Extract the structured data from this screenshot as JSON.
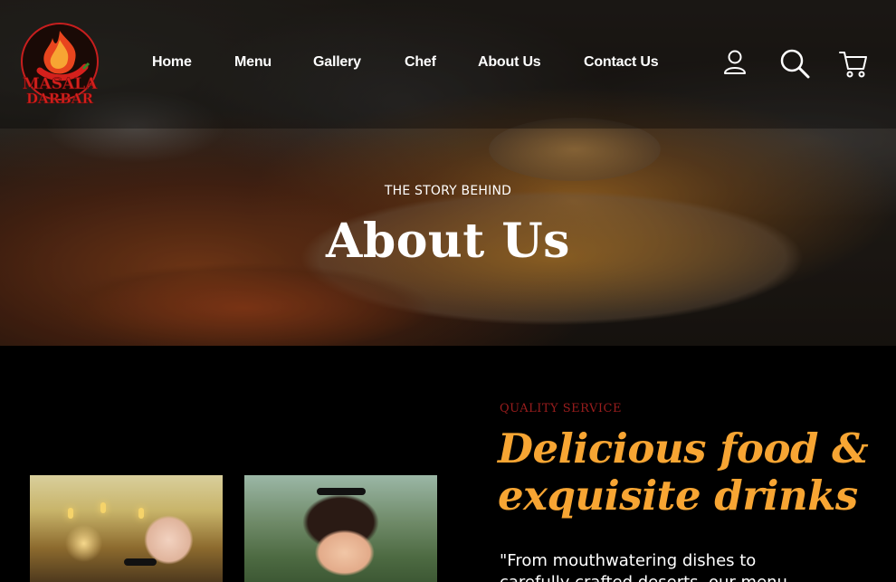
{
  "logo": {
    "name": "MASALA DARBAR",
    "ring_text": "QUEEN OF FLAVORS UNDER ONE ROOF"
  },
  "nav": {
    "items": [
      {
        "label": "Home"
      },
      {
        "label": "Menu"
      },
      {
        "label": "Gallery"
      },
      {
        "label": "Chef"
      },
      {
        "label": "About Us"
      },
      {
        "label": "Contact Us"
      }
    ],
    "icons": [
      "user-icon",
      "search-icon",
      "cart-icon"
    ]
  },
  "hero": {
    "eyebrow": "THE STORY BEHIND",
    "title": "About Us"
  },
  "about": {
    "label": "QUALITY SERVICE",
    "heading_line1": "Delicious food &",
    "heading_line2": "exquisite drinks",
    "body": "\"From mouthwatering dishes to carefully crafted deserts, our menu"
  },
  "colors": {
    "accent_orange": "#f7a533",
    "label_red": "#9a1d1d",
    "background": "#000000",
    "logo_red": "#c81e1e"
  }
}
